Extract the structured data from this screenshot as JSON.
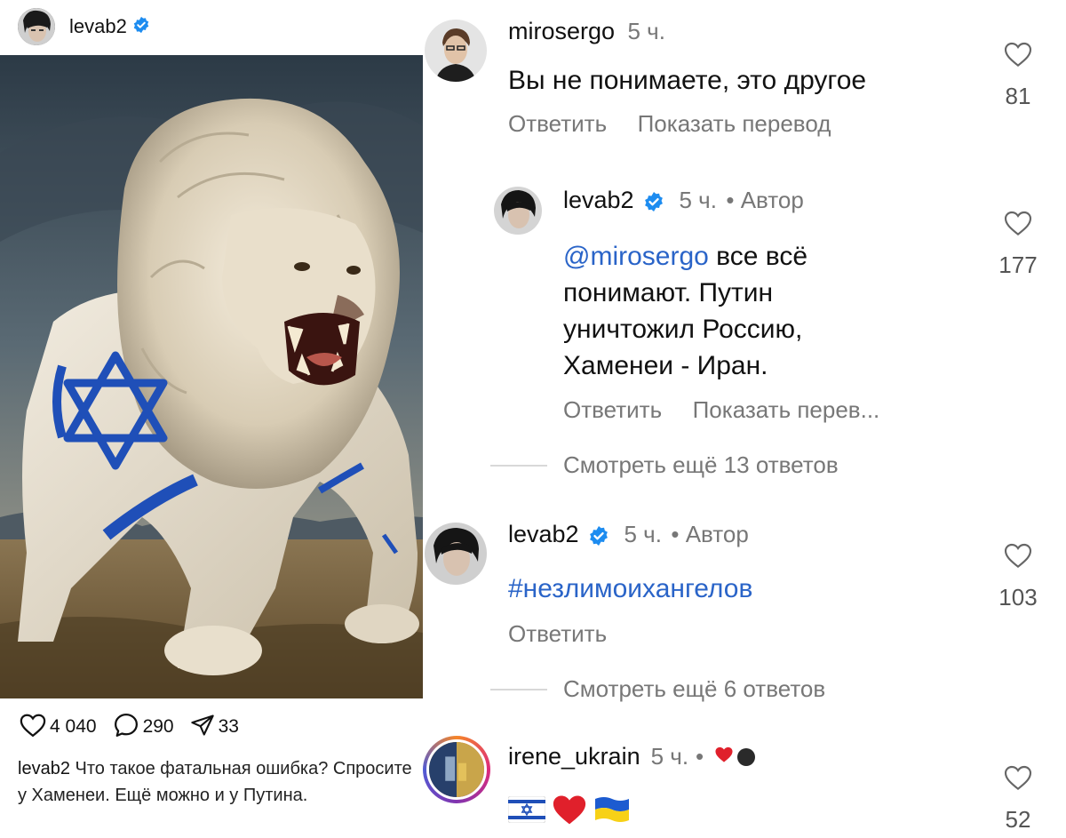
{
  "post": {
    "username": "levab2",
    "likes": "4 040",
    "comments": "290",
    "shares": "33",
    "caption_user": "levab2",
    "caption_text": "Что такое фатальная ошибка? Спросите у Хаменеи. Ещё можно и у Путина."
  },
  "comments": [
    {
      "username": "mirosergo",
      "time": "5 ч.",
      "text": "Вы не понимаете, это другое",
      "reply_label": "Ответить",
      "translate_label": "Показать перевод",
      "likes": "81"
    },
    {
      "username": "levab2",
      "time": "5 ч.",
      "author_label": "• Автор",
      "mention": "@mirosergo",
      "text_1": " все всё",
      "text_2": "понимают. Путин",
      "text_3": "уничтожил Россию,",
      "text_4": "Хаменеи - Иран.",
      "reply_label": "Ответить",
      "translate_label": "Показать перев...",
      "likes": "177",
      "more_replies": "Смотреть ещё 13 ответов"
    },
    {
      "username": "levab2",
      "time": "5 ч.",
      "author_label": "• Автор",
      "hashtag": "#незлимоихангелов",
      "reply_label": "Ответить",
      "likes": "103",
      "more_replies": "Смотреть ещё 6 ответов"
    },
    {
      "username": "irene_ukrain",
      "time": "5 ч.",
      "dot": "•",
      "likes": "52"
    }
  ],
  "colors": {
    "verified": "#1d8cf0",
    "link": "#2a64c8",
    "heart": "#e0202b",
    "ukraine_blue": "#1c5bd0",
    "ukraine_yellow": "#f7d117",
    "israel_blue": "#1f4fb8"
  },
  "icons": {
    "verified": "verified-badge-icon",
    "like": "heart-outline-icon",
    "comment": "comment-bubble-icon",
    "share": "send-paper-plane-icon"
  }
}
